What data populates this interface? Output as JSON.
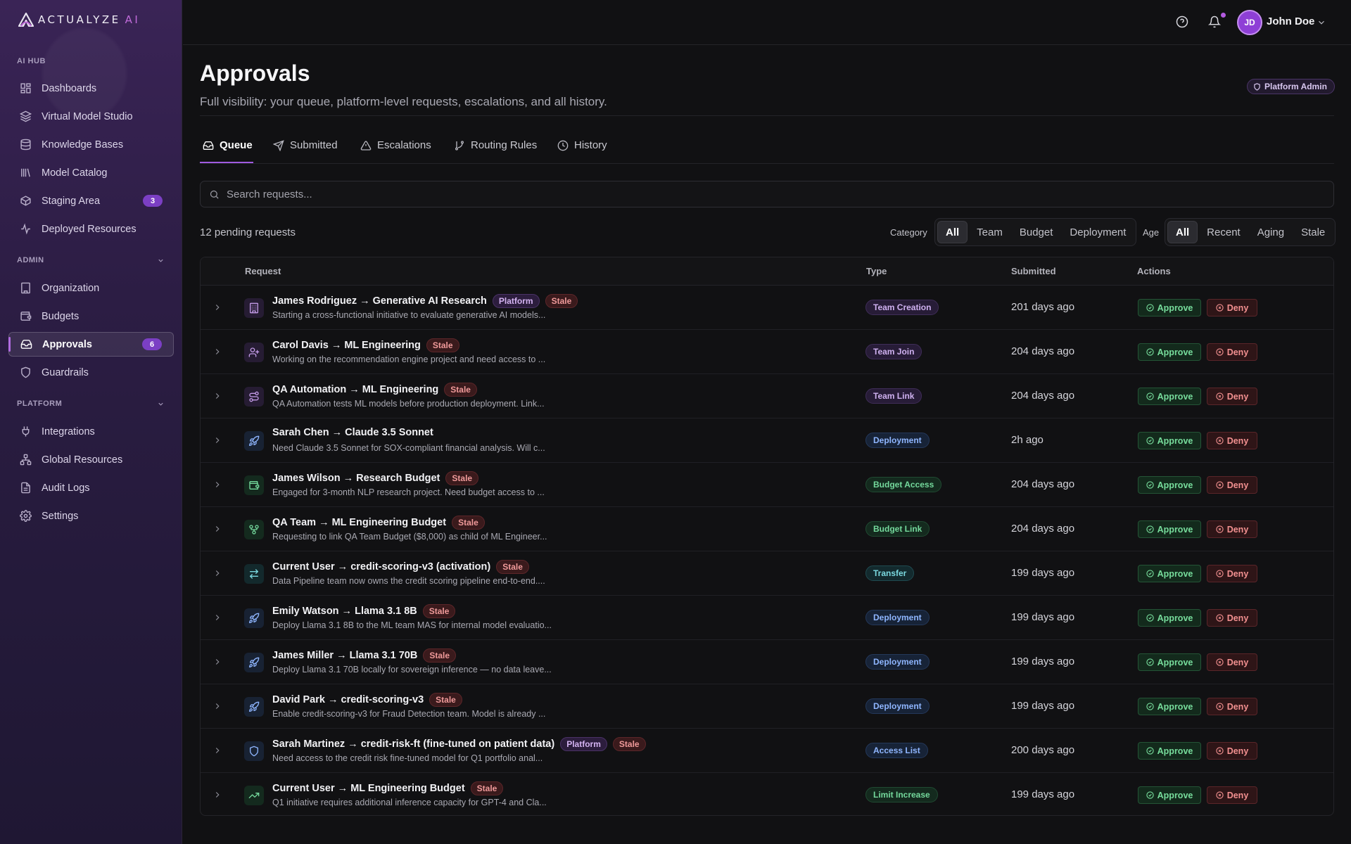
{
  "brand": {
    "name": "ACTUALYZE",
    "suffix": "AI"
  },
  "sidebar": {
    "sections": [
      {
        "label": "AI HUB",
        "collapsible": false
      },
      {
        "label": "ADMIN",
        "collapsible": true
      },
      {
        "label": "PLATFORM",
        "collapsible": true
      }
    ],
    "items": [
      {
        "label": "Dashboards",
        "icon": "grid-icon"
      },
      {
        "label": "Virtual Model Studio",
        "icon": "layers-icon"
      },
      {
        "label": "Knowledge Bases",
        "icon": "database-icon"
      },
      {
        "label": "Model Catalog",
        "icon": "library-icon"
      },
      {
        "label": "Staging Area",
        "icon": "package-icon",
        "badge": "3"
      },
      {
        "label": "Deployed Resources",
        "icon": "activity-icon"
      },
      {
        "label": "Organization",
        "icon": "building-icon"
      },
      {
        "label": "Budgets",
        "icon": "wallet-icon"
      },
      {
        "label": "Approvals",
        "icon": "inbox-icon",
        "badge": "6",
        "active": true
      },
      {
        "label": "Guardrails",
        "icon": "shield-icon"
      },
      {
        "label": "Integrations",
        "icon": "plug-icon"
      },
      {
        "label": "Global Resources",
        "icon": "network-icon"
      },
      {
        "label": "Audit Logs",
        "icon": "file-text-icon"
      },
      {
        "label": "Settings",
        "icon": "gear-icon"
      }
    ]
  },
  "topbar": {
    "user_name": "John Doe",
    "user_initials": "JD",
    "has_notification": true
  },
  "header": {
    "title": "Approvals",
    "subtitle": "Full visibility: your queue, platform-level requests, escalations, and all history.",
    "role_badge": "Platform Admin"
  },
  "tabs": [
    {
      "label": "Queue",
      "icon": "inbox-icon",
      "active": true
    },
    {
      "label": "Submitted",
      "icon": "send-icon"
    },
    {
      "label": "Escalations",
      "icon": "alert-triangle-icon"
    },
    {
      "label": "Routing Rules",
      "icon": "git-branch-icon"
    },
    {
      "label": "History",
      "icon": "clock-icon"
    }
  ],
  "search": {
    "placeholder": "Search requests...",
    "value": ""
  },
  "summary": {
    "pending_text": "12 pending requests"
  },
  "filters": {
    "category": {
      "label": "Category",
      "options": [
        "All",
        "Team",
        "Budget",
        "Deployment"
      ],
      "selected": "All"
    },
    "age": {
      "label": "Age",
      "options": [
        "All",
        "Recent",
        "Aging",
        "Stale"
      ],
      "selected": "All"
    }
  },
  "table": {
    "columns": [
      "Request",
      "Type",
      "Submitted",
      "Actions"
    ],
    "approve_label": "Approve",
    "deny_label": "Deny",
    "rows": [
      {
        "icon": "building-icon",
        "icon_color": "#c39be8",
        "title": "James Rodriguez → Generative AI Research",
        "platform": true,
        "stale": true,
        "description": "Starting a cross-functional initiative to evaluate generative AI models...",
        "type": "Team Creation",
        "type_color": "purple",
        "submitted": "201 days ago"
      },
      {
        "icon": "user-plus-icon",
        "icon_color": "#c39be8",
        "title": "Carol Davis → ML Engineering",
        "platform": false,
        "stale": true,
        "description": "Working on the recommendation engine project and need access to ...",
        "type": "Team Join",
        "type_color": "purple",
        "submitted": "204 days ago"
      },
      {
        "icon": "route-icon",
        "icon_color": "#c39be8",
        "title": "QA Automation → ML Engineering",
        "platform": false,
        "stale": true,
        "description": "QA Automation tests ML models before production deployment. Link...",
        "type": "Team Link",
        "type_color": "purple",
        "submitted": "204 days ago"
      },
      {
        "icon": "rocket-icon",
        "icon_color": "#8fb6ff",
        "title": "Sarah Chen → Claude 3.5 Sonnet",
        "platform": false,
        "stale": false,
        "description": "Need Claude 3.5 Sonnet for SOX-compliant financial analysis. Will c...",
        "type": "Deployment",
        "type_color": "blue",
        "submitted": "2h ago"
      },
      {
        "icon": "wallet-icon",
        "icon_color": "#74d99c",
        "title": "James Wilson → Research Budget",
        "platform": false,
        "stale": true,
        "description": "Engaged for 3-month NLP research project. Need budget access to ...",
        "type": "Budget Access",
        "type_color": "green",
        "submitted": "204 days ago"
      },
      {
        "icon": "git-fork-icon",
        "icon_color": "#74d99c",
        "title": "QA Team → ML Engineering Budget",
        "platform": false,
        "stale": true,
        "description": "Requesting to link QA Team Budget ($8,000) as child of ML Engineer...",
        "type": "Budget Link",
        "type_color": "green",
        "submitted": "204 days ago"
      },
      {
        "icon": "transfer-icon",
        "icon_color": "#7ad8df",
        "title": "Current User → credit-scoring-v3 (activation)",
        "platform": false,
        "stale": true,
        "description": "Data Pipeline team now owns the credit scoring pipeline end-to-end....",
        "type": "Transfer",
        "type_color": "cyan",
        "submitted": "199 days ago"
      },
      {
        "icon": "rocket-icon",
        "icon_color": "#8fb6ff",
        "title": "Emily Watson → Llama 3.1 8B",
        "platform": false,
        "stale": true,
        "description": "Deploy Llama 3.1 8B to the ML team MAS for internal model evaluatio...",
        "type": "Deployment",
        "type_color": "blue",
        "submitted": "199 days ago"
      },
      {
        "icon": "rocket-icon",
        "icon_color": "#8fb6ff",
        "title": "James Miller → Llama 3.1 70B",
        "platform": false,
        "stale": true,
        "description": "Deploy Llama 3.1 70B locally for sovereign inference — no data leave...",
        "type": "Deployment",
        "type_color": "blue",
        "submitted": "199 days ago"
      },
      {
        "icon": "rocket-icon",
        "icon_color": "#8fb6ff",
        "title": "David Park → credit-scoring-v3",
        "platform": false,
        "stale": true,
        "description": "Enable credit-scoring-v3 for Fraud Detection team. Model is already ...",
        "type": "Deployment",
        "type_color": "blue",
        "submitted": "199 days ago"
      },
      {
        "icon": "shield-icon",
        "icon_color": "#8fb6ff",
        "title": "Sarah Martinez → credit-risk-ft (fine-tuned on patient data)",
        "platform": true,
        "stale": true,
        "description": "Need access to the credit risk fine-tuned model for Q1 portfolio anal...",
        "type": "Access List",
        "type_color": "blue",
        "submitted": "200 days ago"
      },
      {
        "icon": "trending-up-icon",
        "icon_color": "#74d99c",
        "title": "Current User → ML Engineering Budget",
        "platform": false,
        "stale": true,
        "description": "Q1 initiative requires additional inference capacity for GPT-4 and Cla...",
        "type": "Limit Increase",
        "type_color": "green",
        "submitted": "199 days ago"
      }
    ]
  },
  "labels": {
    "platform_pill": "Platform",
    "stale_pill": "Stale"
  }
}
